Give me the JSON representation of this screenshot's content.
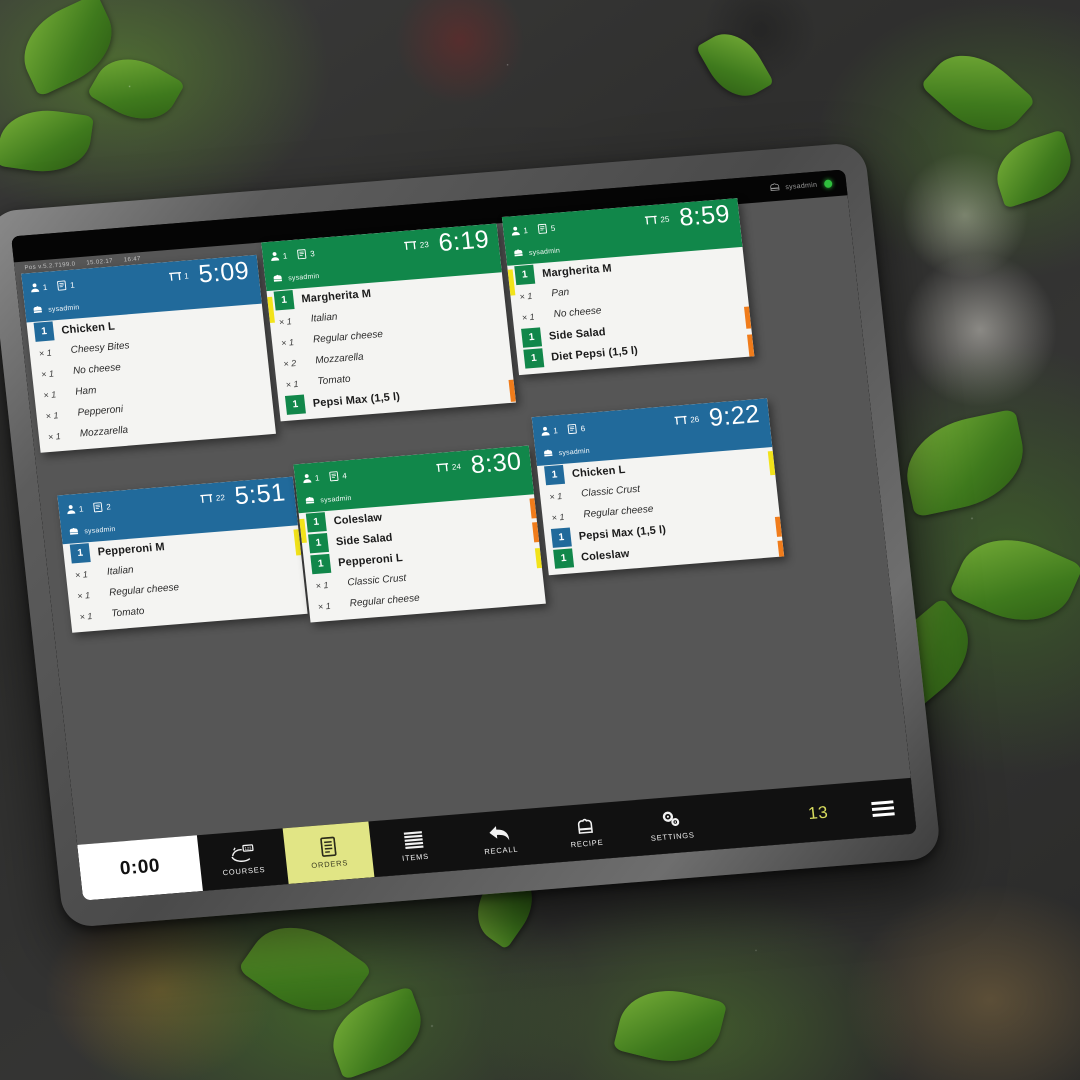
{
  "os_bar": {
    "user_icon": "chef-hat-icon",
    "user": "sysadmin",
    "status": "online"
  },
  "app": {
    "version_line": "Pos v.5.2.7199.0",
    "version_date": "15.02.17",
    "version_time": "16:47"
  },
  "tickets": [
    {
      "id": "ticket-1",
      "color": "blue",
      "timer": "5:09",
      "guests": "1",
      "order_no": "1",
      "table_no": "1",
      "user": "sysadmin",
      "lines": [
        {
          "type": "product",
          "qty": "1",
          "name": "Chicken L"
        },
        {
          "type": "modifier",
          "qty": "× 1",
          "name": "Cheesy Bites"
        },
        {
          "type": "modifier",
          "qty": "× 1",
          "name": "No cheese"
        },
        {
          "type": "modifier",
          "qty": "× 1",
          "name": "Ham"
        },
        {
          "type": "modifier",
          "qty": "× 1",
          "name": "Pepperoni"
        },
        {
          "type": "modifier",
          "qty": "× 1",
          "name": "Mozzarella"
        }
      ]
    },
    {
      "id": "ticket-2",
      "color": "green",
      "timer": "6:19",
      "guests": "1",
      "order_no": "3",
      "table_no": "23",
      "user": "sysadmin",
      "lines": [
        {
          "type": "product",
          "qty": "1",
          "name": "Margherita M"
        },
        {
          "type": "modifier",
          "qty": "× 1",
          "name": "Italian"
        },
        {
          "type": "modifier",
          "qty": "× 1",
          "name": "Regular cheese"
        },
        {
          "type": "modifier",
          "qty": "× 2",
          "name": "Mozzarella"
        },
        {
          "type": "modifier",
          "qty": "× 1",
          "name": "Tomato"
        },
        {
          "type": "product",
          "qty": "1",
          "name": "Pepsi Max (1,5 l)"
        }
      ]
    },
    {
      "id": "ticket-3",
      "color": "green",
      "timer": "8:59",
      "guests": "1",
      "order_no": "5",
      "table_no": "25",
      "user": "sysadmin",
      "lines": [
        {
          "type": "product",
          "qty": "1",
          "name": "Margherita M"
        },
        {
          "type": "modifier",
          "qty": "× 1",
          "name": "Pan"
        },
        {
          "type": "modifier",
          "qty": "× 1",
          "name": "No cheese"
        },
        {
          "type": "product",
          "qty": "1",
          "name": "Side Salad"
        },
        {
          "type": "product",
          "qty": "1",
          "name": "Diet Pepsi (1,5 l)"
        }
      ]
    },
    {
      "id": "ticket-4",
      "color": "blue",
      "timer": "5:51",
      "guests": "1",
      "order_no": "2",
      "table_no": "22",
      "user": "sysadmin",
      "lines": [
        {
          "type": "product",
          "qty": "1",
          "name": "Pepperoni M"
        },
        {
          "type": "modifier",
          "qty": "× 1",
          "name": "Italian"
        },
        {
          "type": "modifier",
          "qty": "× 1",
          "name": "Regular cheese"
        },
        {
          "type": "modifier",
          "qty": "× 1",
          "name": "Tomato"
        }
      ]
    },
    {
      "id": "ticket-5",
      "color": "green",
      "timer": "8:30",
      "guests": "1",
      "order_no": "4",
      "table_no": "24",
      "user": "sysadmin",
      "lines": [
        {
          "type": "product",
          "qty": "1",
          "name": "Coleslaw"
        },
        {
          "type": "product",
          "qty": "1",
          "name": "Side Salad"
        },
        {
          "type": "product",
          "qty": "1",
          "name": "Pepperoni L"
        },
        {
          "type": "modifier",
          "qty": "× 1",
          "name": "Classic Crust"
        },
        {
          "type": "modifier",
          "qty": "× 1",
          "name": "Regular cheese"
        }
      ]
    },
    {
      "id": "ticket-6",
      "color": "blue",
      "timer": "9:22",
      "guests": "1",
      "order_no": "6",
      "table_no": "26",
      "user": "sysadmin",
      "lines": [
        {
          "type": "product",
          "qty": "1",
          "name": "Chicken L",
          "badge": "blue"
        },
        {
          "type": "modifier",
          "qty": "× 1",
          "name": "Classic Crust"
        },
        {
          "type": "modifier",
          "qty": "× 1",
          "name": "Regular cheese"
        },
        {
          "type": "product",
          "qty": "1",
          "name": "Pepsi Max (1,5 l)",
          "badge": "blue"
        },
        {
          "type": "product",
          "qty": "1",
          "name": "Coleslaw",
          "badge": "green"
        }
      ]
    }
  ],
  "toolbar": {
    "timer": "0:00",
    "buttons": [
      {
        "label": "COURSES",
        "icon": "courses-icon",
        "active": false
      },
      {
        "label": "ORDERS",
        "icon": "orders-icon",
        "active": true
      },
      {
        "label": "ITEMS",
        "icon": "items-icon",
        "active": false
      },
      {
        "label": "RECALL",
        "icon": "recall-icon",
        "active": false
      },
      {
        "label": "RECIPE",
        "icon": "recipe-icon",
        "active": false
      },
      {
        "label": "SETTINGS",
        "icon": "settings-icon",
        "active": false
      }
    ],
    "order_count": "13",
    "menu_icon": "hamburger-menu-icon"
  },
  "colors": {
    "blue": "#216a9b",
    "green": "#11874a",
    "accent_yellow": "#e1e585",
    "stripe_yellow": "#f2e31a",
    "stripe_orange": "#f07c1b",
    "app_background": "#565656",
    "toolbar_background": "#111111",
    "count_text": "#d8dc5e"
  }
}
